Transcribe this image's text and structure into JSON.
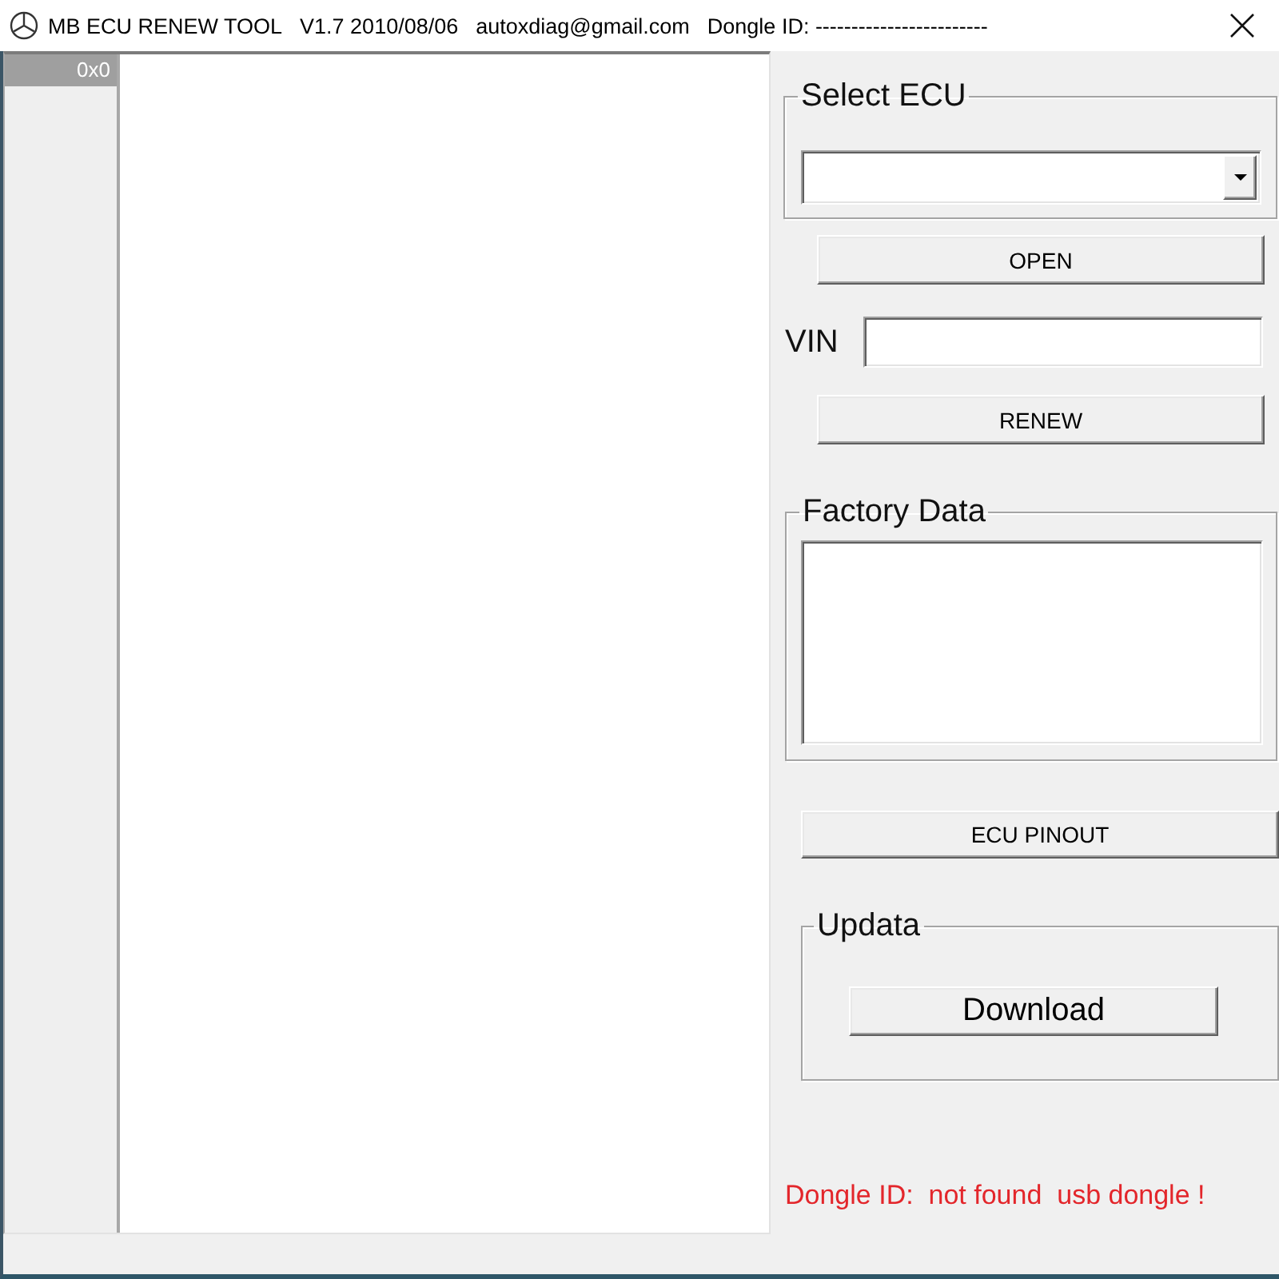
{
  "window": {
    "title": "MB ECU RENEW TOOL",
    "version": "V1.7 2010/08/06",
    "email": "autoxdiag@gmail.com",
    "dongle_id": "Dongle ID: ------------------------"
  },
  "grid": {
    "header_cell": "0x0"
  },
  "select_ecu": {
    "legend": "Select ECU"
  },
  "open_button": "OPEN",
  "vin": {
    "label": "VIN"
  },
  "renew_button": "RENEW",
  "factory_data": {
    "legend": "Factory Data"
  },
  "pinout_button": "ECU PINOUT",
  "updata": {
    "legend": "Updata",
    "button": "Download"
  },
  "status_message": "Dongle ID:  not found  usb dongle !"
}
